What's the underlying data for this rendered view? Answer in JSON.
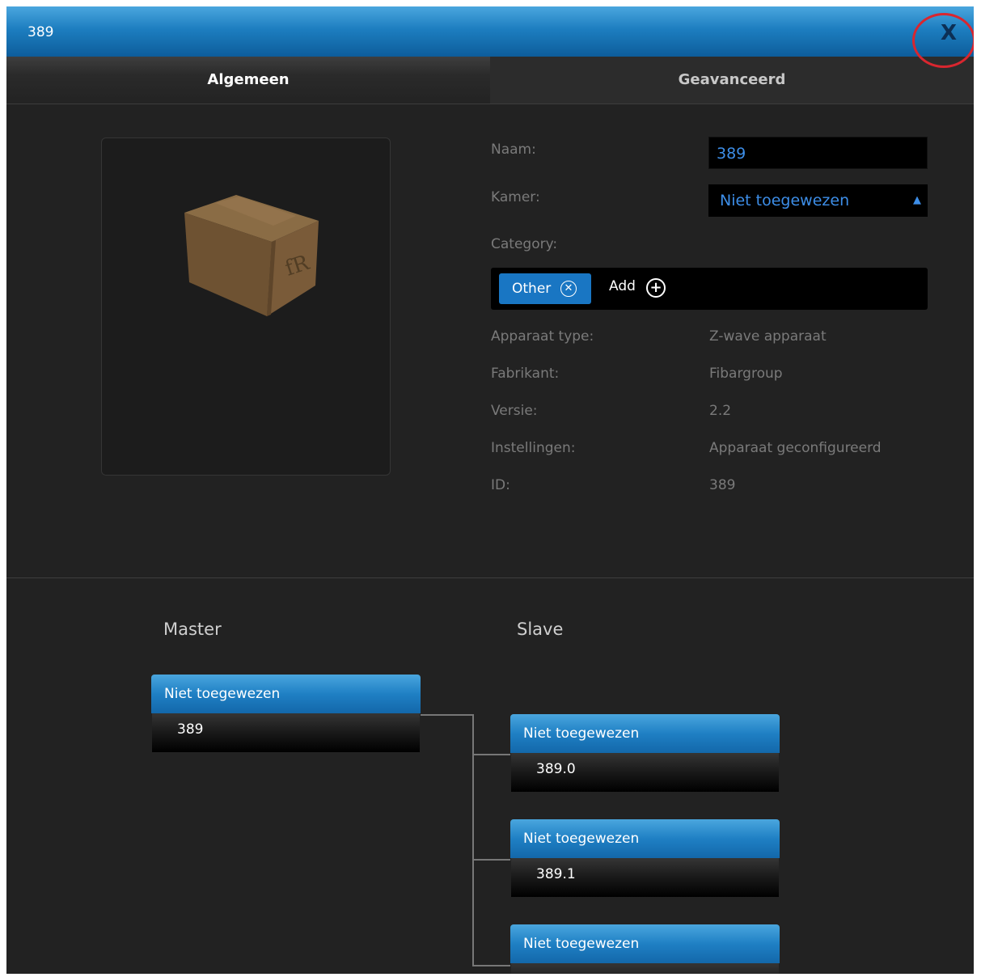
{
  "window": {
    "title": "389",
    "close_label": "X"
  },
  "tabs": [
    {
      "label": "Algemeen",
      "active": true
    },
    {
      "label": "Geavanceerd",
      "active": false
    }
  ],
  "image": {
    "icon": "package-box-icon"
  },
  "form": {
    "name_label": "Naam:",
    "name_value": "389",
    "room_label": "Kamer:",
    "room_value": "Niet toegewezen",
    "category_label": "Category:",
    "category_chip": "Other",
    "add_label": "Add"
  },
  "details": [
    {
      "label": "Apparaat type:",
      "value": "Z-wave apparaat"
    },
    {
      "label": "Fabrikant:",
      "value": "Fibargroup"
    },
    {
      "label": "Versie:",
      "value": "2.2"
    },
    {
      "label": "Instellingen:",
      "value": "Apparaat geconfigureerd"
    },
    {
      "label": "ID:",
      "value": "389"
    }
  ],
  "tree": {
    "master_heading": "Master",
    "slave_heading": "Slave",
    "master": {
      "room": "Niet toegewezen",
      "id": "389"
    },
    "slaves": [
      {
        "room": "Niet toegewezen",
        "id": "389.0"
      },
      {
        "room": "Niet toegewezen",
        "id": "389.1"
      },
      {
        "room": "Niet toegewezen",
        "id": ""
      }
    ]
  },
  "colors": {
    "accent": "#1976c3",
    "highlight_ring": "#d9262f",
    "background": "#222222"
  }
}
